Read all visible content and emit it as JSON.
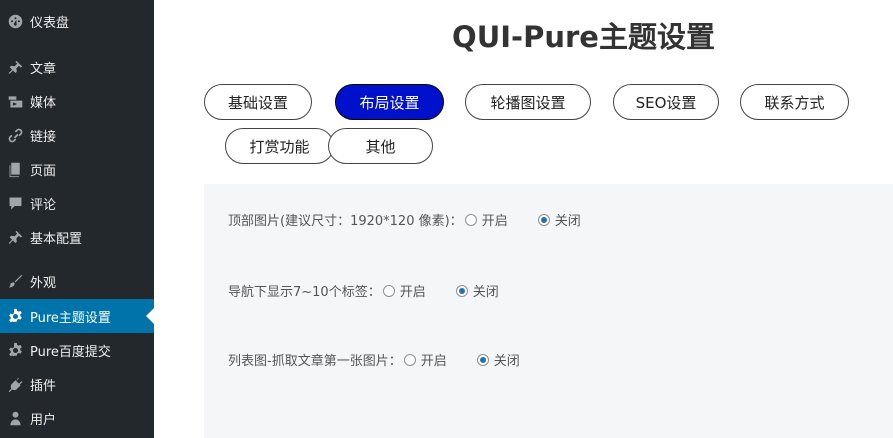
{
  "sidebar": {
    "items": [
      {
        "label": "仪表盘",
        "icon": "dashboard-icon"
      },
      {
        "label": "文章",
        "icon": "pin-icon"
      },
      {
        "label": "媒体",
        "icon": "media-icon"
      },
      {
        "label": "链接",
        "icon": "link-icon"
      },
      {
        "label": "页面",
        "icon": "page-icon"
      },
      {
        "label": "评论",
        "icon": "comment-icon"
      },
      {
        "label": "基本配置",
        "icon": "pin-icon"
      },
      {
        "label": "外观",
        "icon": "brush-icon"
      },
      {
        "label": "Pure主题设置",
        "icon": "gear-icon"
      },
      {
        "label": "Pure百度提交",
        "icon": "gear-icon"
      },
      {
        "label": "插件",
        "icon": "plugin-icon"
      },
      {
        "label": "用户",
        "icon": "user-icon"
      }
    ],
    "active": "Pure主题设置"
  },
  "main": {
    "title": "QUI-Pure主题设置",
    "tabs": [
      "基础设置",
      "布局设置",
      "轮播图设置",
      "SEO设置",
      "联系方式",
      "打赏功能",
      "其他"
    ],
    "active_tab": "布局设置",
    "settings": [
      {
        "label": "顶部图片(建议尺寸：1920*120 像素)：",
        "options": [
          "开启",
          "关闭"
        ],
        "selected": "关闭"
      },
      {
        "label": "导航下显示7~10个标签：",
        "options": [
          "开启",
          "关闭"
        ],
        "selected": "关闭"
      },
      {
        "label": "列表图-抓取文章第一张图片：",
        "options": [
          "开启",
          "关闭"
        ],
        "selected": "关闭"
      }
    ]
  },
  "colors": {
    "sidebar_bg": "#23282d",
    "sidebar_active": "#0073aa",
    "tab_active": "#0011cc",
    "panel_bg": "#f5f6f8",
    "radio_checked": "#2271b1"
  }
}
